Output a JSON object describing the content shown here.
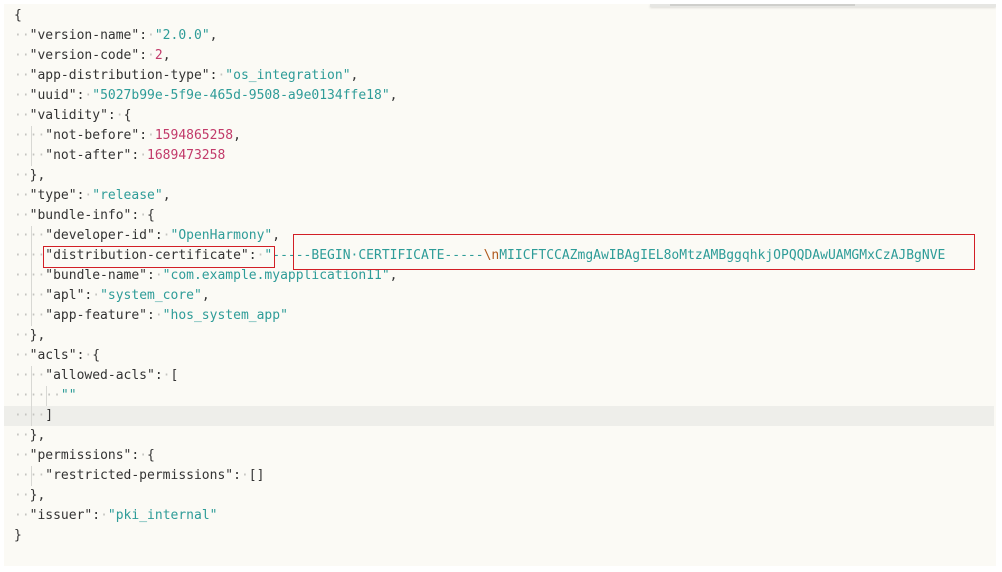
{
  "editor": {
    "lines": [
      {
        "indent": "",
        "code": [
          {
            "t": "p",
            "v": "{"
          }
        ]
      },
      {
        "indent": "··",
        "code": [
          {
            "t": "key",
            "v": "\"version-name\""
          },
          {
            "t": "p",
            "v": ":"
          },
          {
            "t": "ws",
            "v": "·"
          },
          {
            "t": "s",
            "v": "\"2.0.0\""
          },
          {
            "t": "p",
            "v": ","
          }
        ]
      },
      {
        "indent": "··",
        "code": [
          {
            "t": "key",
            "v": "\"version-code\""
          },
          {
            "t": "p",
            "v": ":"
          },
          {
            "t": "ws",
            "v": "·"
          },
          {
            "t": "n",
            "v": "2"
          },
          {
            "t": "p",
            "v": ","
          }
        ]
      },
      {
        "indent": "··",
        "code": [
          {
            "t": "key",
            "v": "\"app-distribution-type\""
          },
          {
            "t": "p",
            "v": ":"
          },
          {
            "t": "ws",
            "v": "·"
          },
          {
            "t": "s",
            "v": "\"os_integration\""
          },
          {
            "t": "p",
            "v": ","
          }
        ]
      },
      {
        "indent": "··",
        "code": [
          {
            "t": "key",
            "v": "\"uuid\""
          },
          {
            "t": "p",
            "v": ":"
          },
          {
            "t": "ws",
            "v": "·"
          },
          {
            "t": "s",
            "v": "\"5027b99e-5f9e-465d-9508-a9e0134ffe18\""
          },
          {
            "t": "p",
            "v": ","
          }
        ]
      },
      {
        "indent": "··",
        "code": [
          {
            "t": "key",
            "v": "\"validity\""
          },
          {
            "t": "p",
            "v": ":"
          },
          {
            "t": "ws",
            "v": "·"
          },
          {
            "t": "p",
            "v": "{"
          }
        ]
      },
      {
        "indent": "····",
        "code": [
          {
            "t": "key",
            "v": "\"not-before\""
          },
          {
            "t": "p",
            "v": ":"
          },
          {
            "t": "ws",
            "v": "·"
          },
          {
            "t": "n",
            "v": "1594865258"
          },
          {
            "t": "p",
            "v": ","
          }
        ]
      },
      {
        "indent": "····",
        "code": [
          {
            "t": "key",
            "v": "\"not-after\""
          },
          {
            "t": "p",
            "v": ":"
          },
          {
            "t": "ws",
            "v": "·"
          },
          {
            "t": "n",
            "v": "1689473258"
          }
        ]
      },
      {
        "indent": "··",
        "code": [
          {
            "t": "p",
            "v": "},"
          }
        ]
      },
      {
        "indent": "··",
        "code": [
          {
            "t": "key",
            "v": "\"type\""
          },
          {
            "t": "p",
            "v": ":"
          },
          {
            "t": "ws",
            "v": "·"
          },
          {
            "t": "s",
            "v": "\"release\""
          },
          {
            "t": "p",
            "v": ","
          }
        ]
      },
      {
        "indent": "··",
        "code": [
          {
            "t": "key",
            "v": "\"bundle-info\""
          },
          {
            "t": "p",
            "v": ":"
          },
          {
            "t": "ws",
            "v": "·"
          },
          {
            "t": "p",
            "v": "{"
          }
        ]
      },
      {
        "indent": "····",
        "code": [
          {
            "t": "key",
            "v": "\"developer-id\""
          },
          {
            "t": "p",
            "v": ":"
          },
          {
            "t": "ws",
            "v": "·"
          },
          {
            "t": "s",
            "v": "\"OpenHarmony\""
          },
          {
            "t": "p",
            "v": ","
          }
        ]
      },
      {
        "indent": "····",
        "code": [
          {
            "t": "key",
            "v": "\"distribution-certificate\""
          },
          {
            "t": "p",
            "v": ":"
          },
          {
            "t": "ws",
            "v": "·"
          },
          {
            "t": "s",
            "v": "\"-----BEGIN·CERTIFICATE-----"
          },
          {
            "t": "esc",
            "v": "\\n"
          },
          {
            "t": "s",
            "v": "MIICFTCCAZmgAwIBAgIEL8oMtzAMBggqhkjOPQQDAwUAMGMxCzAJBgNVE"
          }
        ]
      },
      {
        "indent": "····",
        "code": [
          {
            "t": "key",
            "v": "\"bundle-name\""
          },
          {
            "t": "p",
            "v": ":"
          },
          {
            "t": "ws",
            "v": "·"
          },
          {
            "t": "s",
            "v": "\"com.example.myapplication11\""
          },
          {
            "t": "p",
            "v": ","
          }
        ]
      },
      {
        "indent": "····",
        "code": [
          {
            "t": "key",
            "v": "\"apl\""
          },
          {
            "t": "p",
            "v": ":"
          },
          {
            "t": "ws",
            "v": "·"
          },
          {
            "t": "s",
            "v": "\"system_core\""
          },
          {
            "t": "p",
            "v": ","
          }
        ]
      },
      {
        "indent": "····",
        "code": [
          {
            "t": "key",
            "v": "\"app-feature\""
          },
          {
            "t": "p",
            "v": ":"
          },
          {
            "t": "ws",
            "v": "·"
          },
          {
            "t": "s",
            "v": "\"hos_system_app\""
          }
        ]
      },
      {
        "indent": "··",
        "code": [
          {
            "t": "p",
            "v": "},"
          }
        ]
      },
      {
        "indent": "··",
        "code": [
          {
            "t": "key",
            "v": "\"acls\""
          },
          {
            "t": "p",
            "v": ":"
          },
          {
            "t": "ws",
            "v": "·"
          },
          {
            "t": "p",
            "v": "{"
          }
        ]
      },
      {
        "indent": "····",
        "code": [
          {
            "t": "key",
            "v": "\"allowed-acls\""
          },
          {
            "t": "p",
            "v": ":"
          },
          {
            "t": "ws",
            "v": "·"
          },
          {
            "t": "p",
            "v": "["
          }
        ]
      },
      {
        "indent": "······",
        "code": [
          {
            "t": "s",
            "v": "\"\""
          }
        ]
      },
      {
        "indent": "····",
        "code": [
          {
            "t": "p",
            "v": "]"
          }
        ],
        "active": true
      },
      {
        "indent": "··",
        "code": [
          {
            "t": "p",
            "v": "},"
          }
        ]
      },
      {
        "indent": "··",
        "code": [
          {
            "t": "key",
            "v": "\"permissions\""
          },
          {
            "t": "p",
            "v": ":"
          },
          {
            "t": "ws",
            "v": "·"
          },
          {
            "t": "p",
            "v": "{"
          }
        ]
      },
      {
        "indent": "····",
        "code": [
          {
            "t": "key",
            "v": "\"restricted-permissions\""
          },
          {
            "t": "p",
            "v": ":"
          },
          {
            "t": "ws",
            "v": "·"
          },
          {
            "t": "p",
            "v": "[]"
          }
        ]
      },
      {
        "indent": "··",
        "code": [
          {
            "t": "p",
            "v": "},"
          }
        ]
      },
      {
        "indent": "··",
        "code": [
          {
            "t": "key",
            "v": "\"issuer\""
          },
          {
            "t": "p",
            "v": ":"
          },
          {
            "t": "ws",
            "v": "·"
          },
          {
            "t": "s",
            "v": "\"pki_internal\""
          }
        ]
      },
      {
        "indent": "",
        "code": [
          {
            "t": "p",
            "v": "}"
          }
        ]
      }
    ]
  }
}
